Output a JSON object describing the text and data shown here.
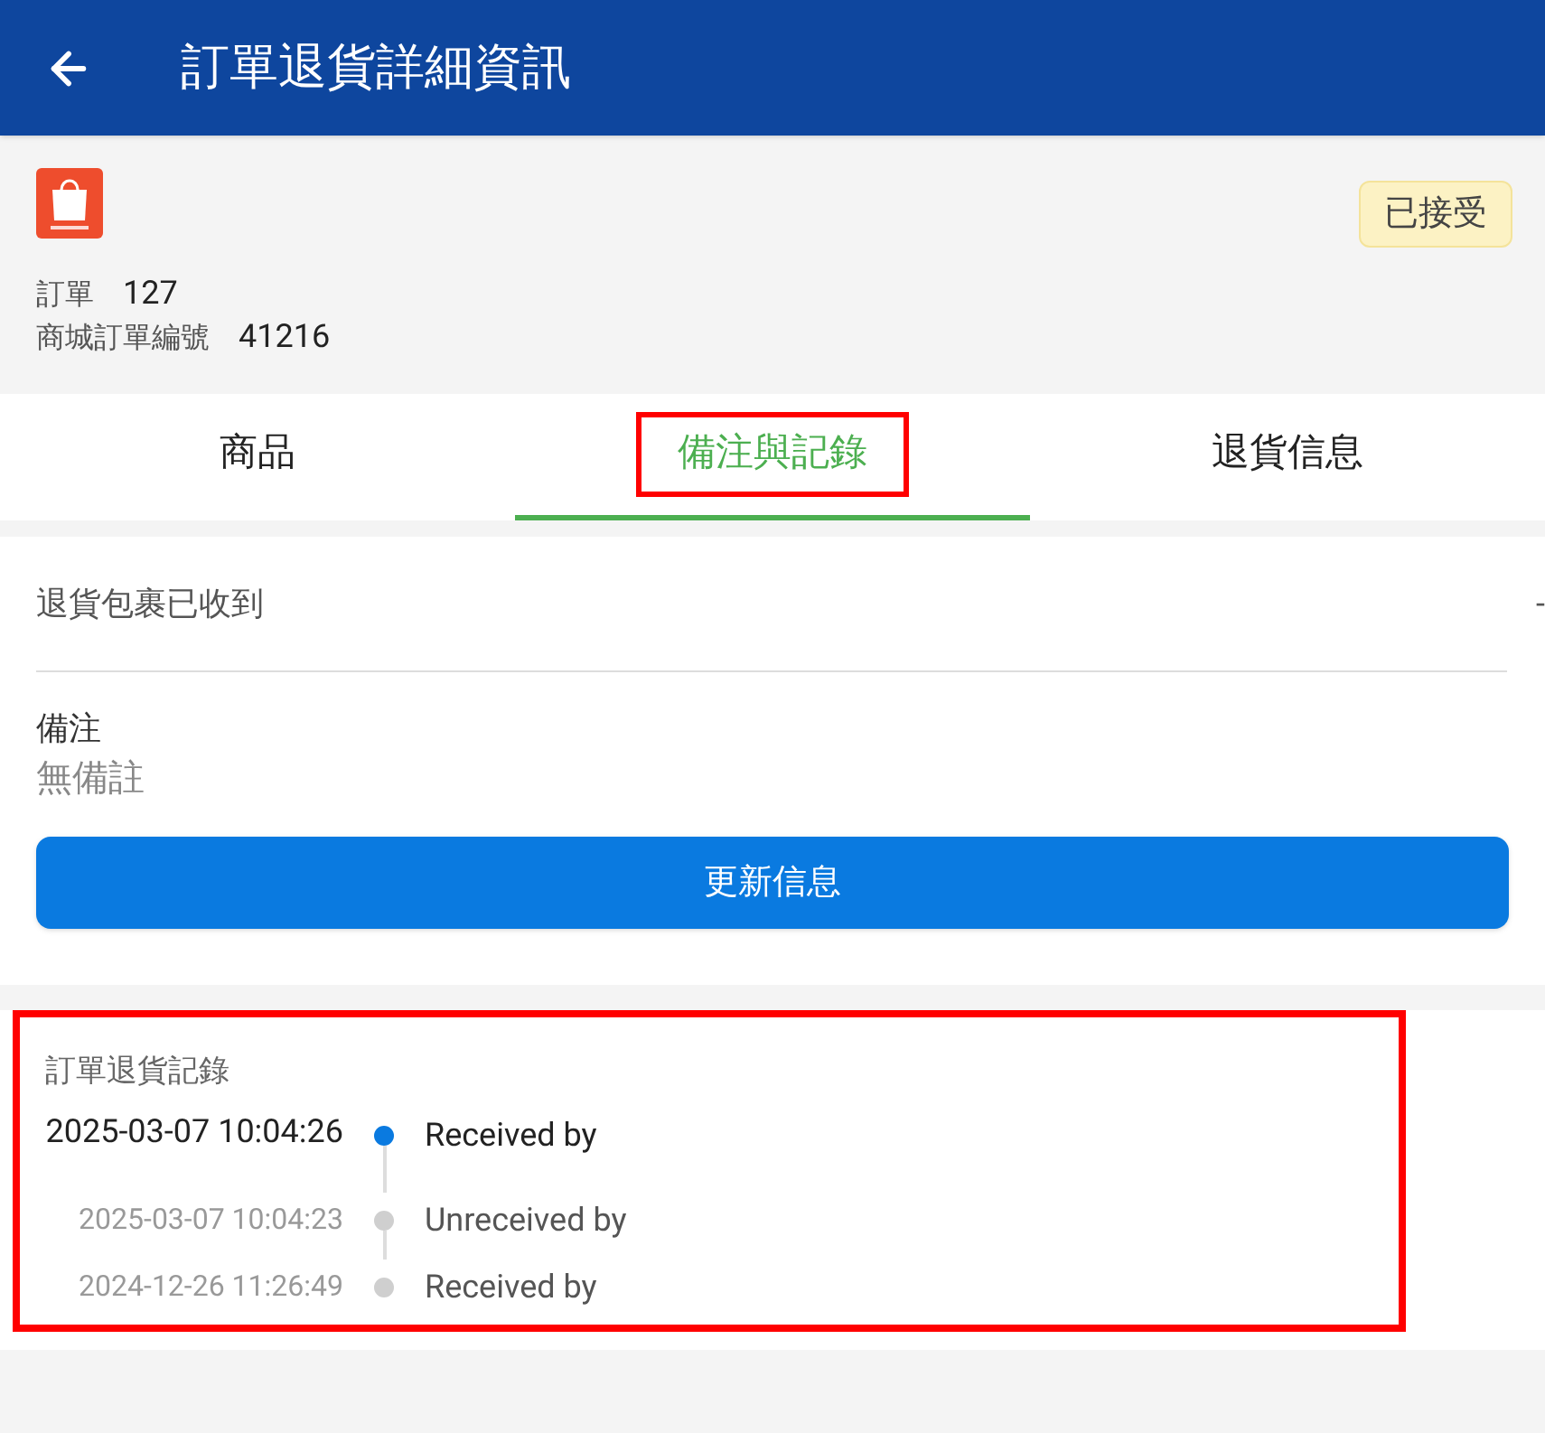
{
  "header": {
    "title": "訂單退貨詳細資訊"
  },
  "order": {
    "status": "已接受",
    "fields": [
      {
        "label": "訂單",
        "value": "127"
      },
      {
        "label": "商城訂單編號",
        "value": "41216"
      }
    ]
  },
  "tabs": [
    {
      "label": "商品",
      "selected": false,
      "highlighted": false
    },
    {
      "label": "備注與記錄",
      "selected": true,
      "highlighted": true
    },
    {
      "label": "退貨信息",
      "selected": false,
      "highlighted": false
    }
  ],
  "details": {
    "received_label": "退貨包裹已收到",
    "received_value": "-",
    "note_label": "備注",
    "note_value": "無備註",
    "update_button": "更新信息"
  },
  "log": {
    "title": "訂單退貨記錄",
    "highlighted": true,
    "entries": [
      {
        "time": "2025-03-07 10:04:26",
        "text": "Received by",
        "active": true
      },
      {
        "time": "2025-03-07 10:04:23",
        "text": "Unreceived by",
        "active": false
      },
      {
        "time": "2024-12-26 11:26:49",
        "text": "Received by",
        "active": false
      }
    ]
  }
}
